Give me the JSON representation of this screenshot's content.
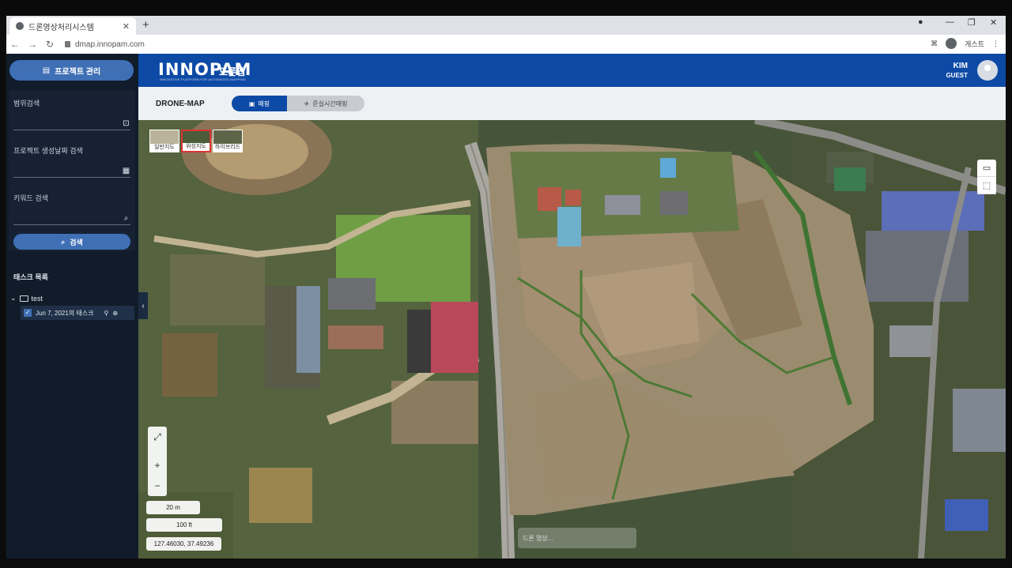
{
  "browser": {
    "tab_title": "드론영상처리시스템",
    "tab_close": "✕",
    "new_tab": "+",
    "url": "dmap.innopam.com",
    "profile_label": "게스트",
    "nav_back": "←",
    "nav_forward": "→",
    "nav_reload": "↻",
    "win_min": "—",
    "win_max": "❐",
    "win_close": "✕"
  },
  "sidebar": {
    "project_button": "프로젝트 관리",
    "search": {
      "range_label": "범위검색",
      "date_label": "프로젝트 생성날짜 검색",
      "keyword_label": "키워드 검색",
      "search_button": "검색"
    },
    "tasks": {
      "heading": "태스크 목록",
      "folder": "test",
      "items": [
        {
          "label": "Jun 7, 2021의 태스크"
        }
      ]
    }
  },
  "header": {
    "logo": "INNOPAM",
    "logo_sub": "INNOVATIVE PLATFORM FOR AUTOMATED MAPPING",
    "app_name": "드론맵",
    "user_name": "KIM",
    "user_role": "GUEST"
  },
  "subbar": {
    "title": "DRONE-MAP",
    "mode_active": "매핑",
    "mode_other": "준실시간매핑"
  },
  "map": {
    "layers": [
      {
        "label": "일반지도"
      },
      {
        "label": "위성지도"
      },
      {
        "label": "하이브리드"
      }
    ],
    "scale_m": "20 m",
    "scale_ft": "100 ft",
    "coords": "127.46030, 37.49236",
    "hint": "드론 영상..."
  }
}
